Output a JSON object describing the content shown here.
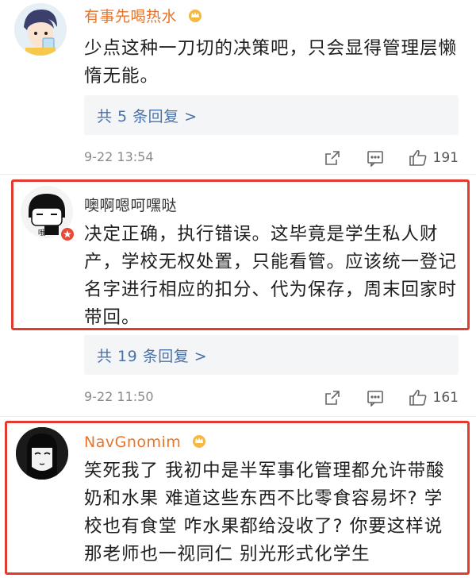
{
  "comments": [
    {
      "username": "有事先喝热水",
      "text_lines": [
        "少点这种一刀切的决策吧，只会显得管理层懒",
        "惰无能。"
      ],
      "replies": "共 5 条回复 >",
      "time": "9-22 13:54",
      "likes": "191"
    },
    {
      "username": "噢啊嗯呵嘿哒",
      "text_lines": [
        "决定正确，执行错误。这毕竟是学生私人财",
        "产，学校无权处置，只能看管。应该统一登记",
        "名字进行相应的扣分、代为保存，周末回家时",
        "带回。"
      ],
      "replies": "共 19 条回复 >",
      "time": "9-22 11:50",
      "likes": "161"
    },
    {
      "username": "NavGnomim",
      "text_lines": [
        "笑死我了 我初中是半军事化管理都允许带酸",
        "奶和水果 难道这些东西不比零食容易坏? 学",
        "校也有食堂 咋水果都给没收了? 你要这样说",
        "那老师也一视同仁 别光形式化学生"
      ]
    }
  ],
  "colors": {
    "highlight_box": "#e23a2e",
    "username_vip": "#e8742b",
    "reply_link": "#4a72a8"
  },
  "icons": [
    "forward-icon",
    "comment-icon",
    "like-icon",
    "vip-crown-icon"
  ]
}
